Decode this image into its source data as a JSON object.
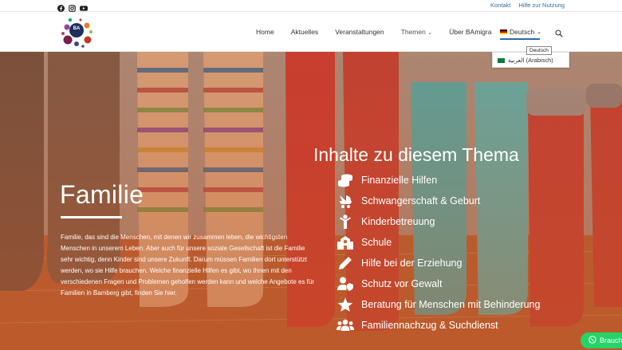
{
  "topbar": {
    "social": [
      "facebook-icon",
      "instagram-icon",
      "youtube-icon"
    ],
    "links": {
      "kontakt": "Kontakt",
      "hilfe": "Hilfe zur Nutzung"
    }
  },
  "logo": {
    "text": "BA"
  },
  "nav": {
    "items": [
      "Home",
      "Aktuelles",
      "Veranstaltungen",
      "Themen",
      "Über BAmigra"
    ],
    "language": "Deutsch"
  },
  "language_menu": {
    "tooltip": "Deutsch",
    "option_arabic": "العربية (Arabisch)"
  },
  "hero": {
    "title": "Familie",
    "text": "Familie, das sind die Menschen, mit denen wir zusammen leben, die wichtigsten Menschen in unserem Leben. Aber auch für unsere soziale Gesellschaft ist die Familie sehr wichtig, denn Kinder sind unsere Zukunft. Darum müssen Familien dort unterstützt werden, wo sie Hilfe brauchen. Welche finanzielle Hilfen es gibt, wo Ihnen mit den verschiedenen Fragen und Problemen geholfen werden kann und welche Angebote es für Familien in Bamberg gibt, finden Sie hier."
  },
  "topics": {
    "title": "Inhalte zu diesem Thema",
    "items": [
      {
        "label": "Finanzielle Hilfen",
        "icon": "coins-icon"
      },
      {
        "label": "Schwangerschaft & Geburt",
        "icon": "baby-carriage-icon"
      },
      {
        "label": "Kinderbetreuung",
        "icon": "child-icon"
      },
      {
        "label": "Schule",
        "icon": "school-icon"
      },
      {
        "label": "Hilfe bei der Erziehung",
        "icon": "pencil-icon"
      },
      {
        "label": "Schutz vor Gewalt",
        "icon": "user-shield-icon"
      },
      {
        "label": "Beratung für Menschen mit Behinderung",
        "icon": "star-icon"
      },
      {
        "label": "Familiennachzug & Suchdienst",
        "icon": "users-icon"
      }
    ]
  },
  "whatsapp": {
    "label": "Brauch"
  }
}
